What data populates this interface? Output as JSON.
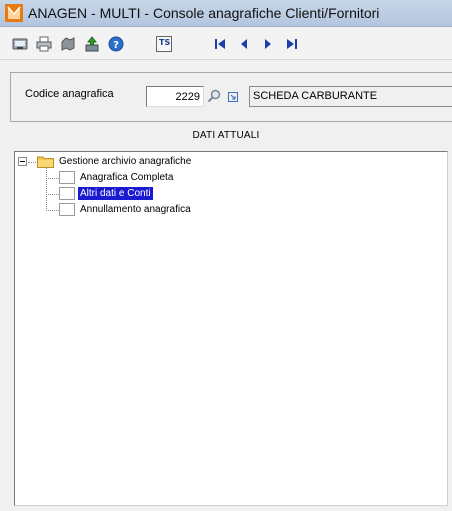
{
  "window": {
    "title": "ANAGEN  - MULTI -  Console anagrafiche Clienti/Fornitori"
  },
  "toolbar": {
    "buttons": [
      {
        "name": "print-preview",
        "icon": "preview-icon"
      },
      {
        "name": "print",
        "icon": "printer-icon"
      },
      {
        "name": "tools",
        "icon": "tools-icon"
      },
      {
        "name": "install",
        "icon": "install-icon"
      },
      {
        "name": "help",
        "icon": "help-icon"
      },
      {
        "name": "ts",
        "label": "TS"
      },
      {
        "name": "first-record",
        "icon": "first-icon"
      },
      {
        "name": "previous-record",
        "icon": "previous-icon"
      },
      {
        "name": "next-record",
        "icon": "next-icon"
      },
      {
        "name": "last-record",
        "icon": "last-icon"
      }
    ],
    "ts_label": "TS"
  },
  "form": {
    "code_label": "Codice anagrafica",
    "code_value": "2229",
    "description": "SCHEDA CARBURANTE"
  },
  "section": {
    "title": "DATI ATTUALI"
  },
  "tree": {
    "root": "Gestione archivio anagrafiche",
    "items": [
      {
        "label": "Anagrafica Completa",
        "selected": false
      },
      {
        "label": "Altri dati e Conti",
        "selected": true
      },
      {
        "label": "Annullamento anagrafica",
        "selected": false
      }
    ]
  },
  "colors": {
    "selection": "#1a1ad0",
    "titlebar": "#b9cbe2"
  }
}
